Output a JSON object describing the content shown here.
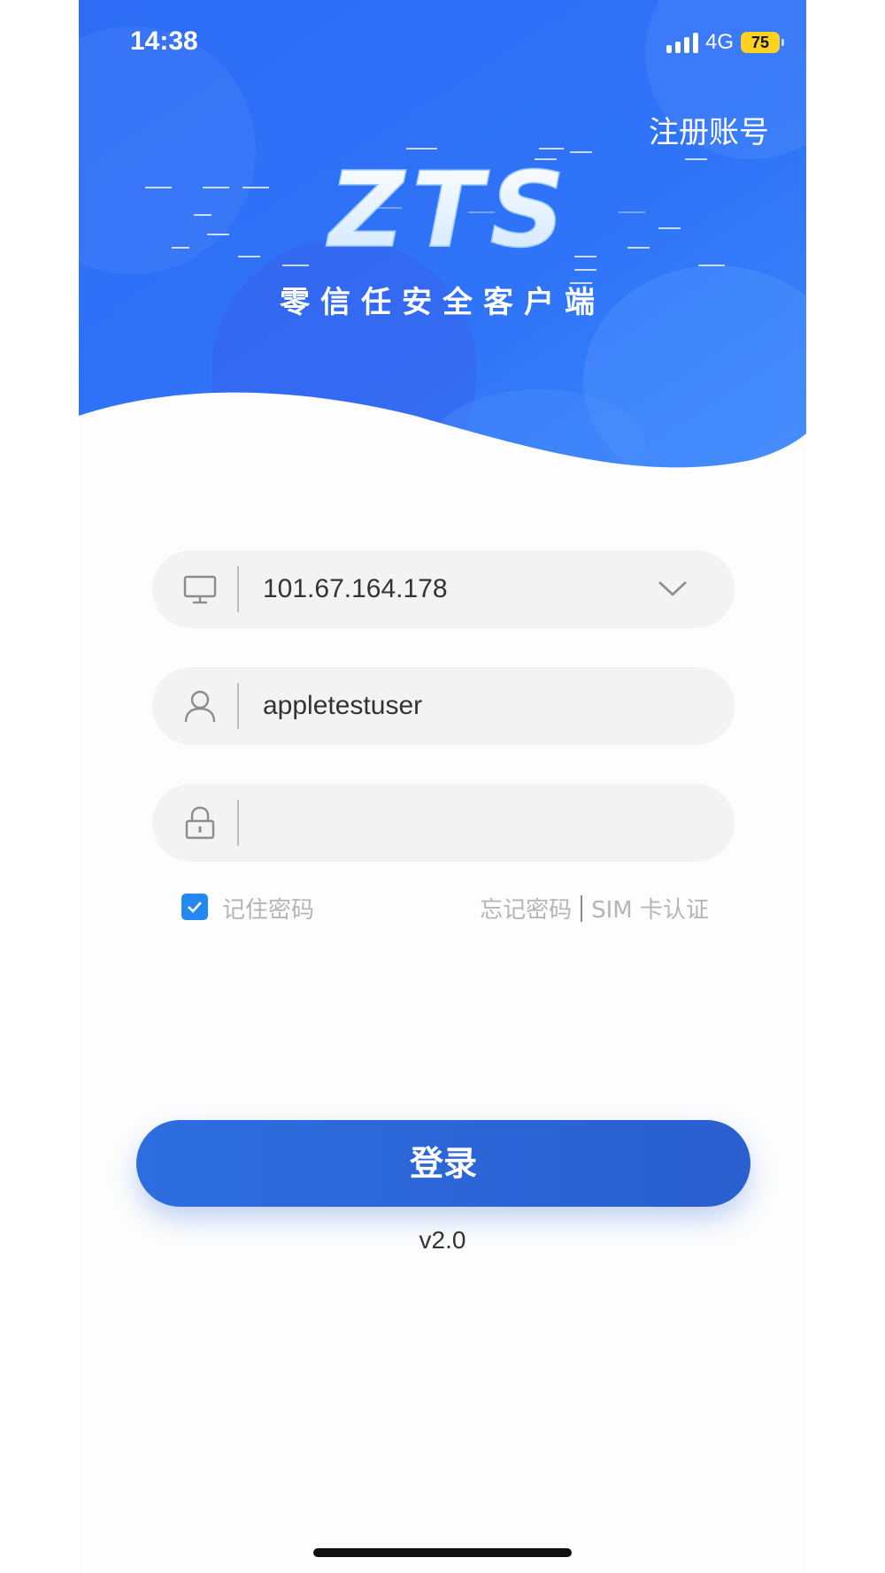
{
  "status_bar": {
    "time": "14:38",
    "network": "4G",
    "battery": "75"
  },
  "header": {
    "register_label": "注册账号",
    "logo_text": "ZTS",
    "tagline": "零信任安全客户端"
  },
  "form": {
    "server": {
      "value": "101.67.164.178",
      "icon": "monitor-icon",
      "dropdown_icon": "chevron-down-icon"
    },
    "username": {
      "value": "appletestuser",
      "icon": "user-icon"
    },
    "password": {
      "value": "",
      "icon": "lock-icon"
    },
    "remember": {
      "label": "记住密码",
      "checked": true
    },
    "forgot_label": "忘记密码",
    "sim_label": "SIM 卡认证"
  },
  "login_label": "登录",
  "version": "v2.0",
  "colors": {
    "header_blue": "#2f6ff5",
    "button_blue": "#2d6de0",
    "checkbox_blue": "#2389f0"
  }
}
